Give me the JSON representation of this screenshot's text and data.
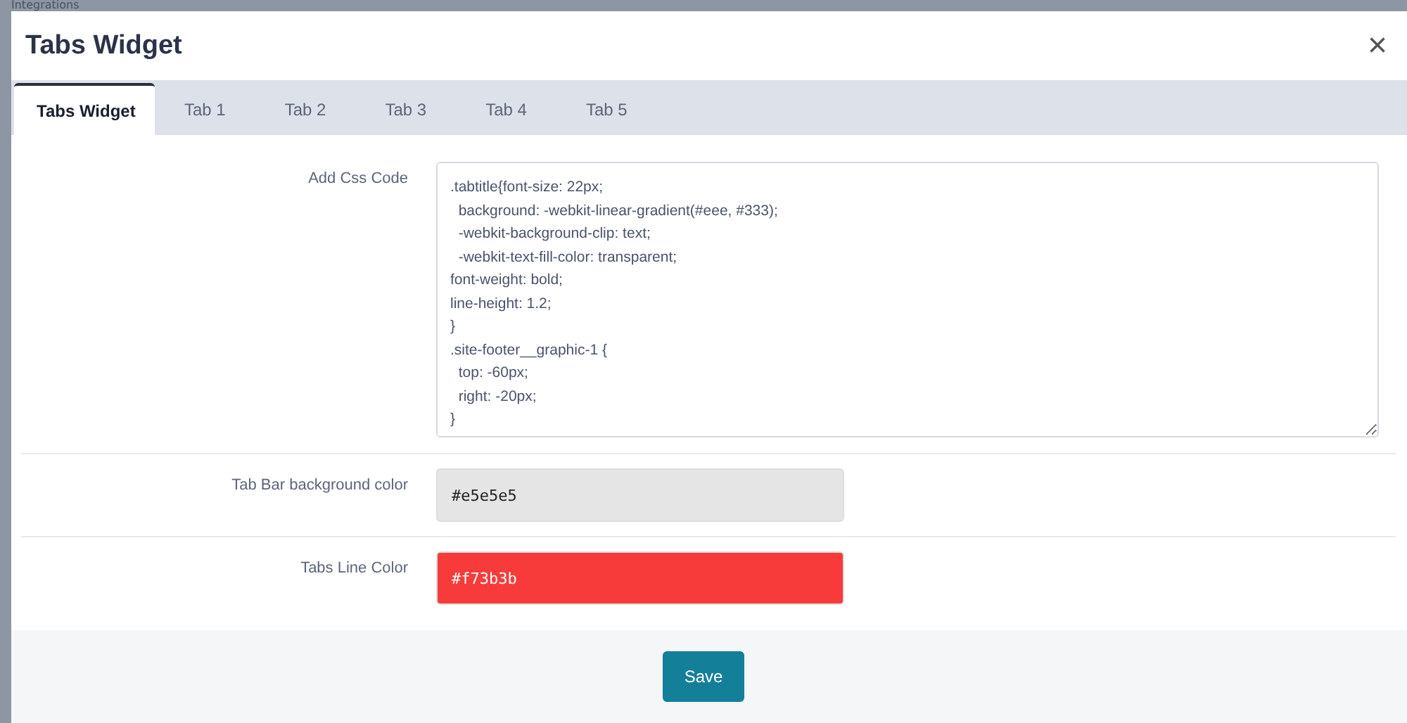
{
  "backdrop": {
    "sidebar_label": "Integrations"
  },
  "dialog": {
    "title": "Tabs Widget",
    "close": "×"
  },
  "tabs": [
    {
      "label": "Tabs Widget",
      "selected": true
    },
    {
      "label": "Tab 1",
      "selected": false
    },
    {
      "label": "Tab 2",
      "selected": false
    },
    {
      "label": "Tab 3",
      "selected": false
    },
    {
      "label": "Tab 4",
      "selected": false
    },
    {
      "label": "Tab 5",
      "selected": false
    }
  ],
  "fields": [
    {
      "kind": "code",
      "label": "Add Css Code",
      "lines": [
        ".tabtitle{font-size: 22px;",
        "  background: -webkit-linear-gradient(#eee, #333);",
        "  -webkit-background-clip: text;",
        "  -webkit-text-fill-color: transparent;",
        "font-weight: bold;",
        "line-height: 1.2;",
        "}",
        ".site-footer__graphic-1 {",
        "  top: -60px;",
        "  right: -20px;",
        "}"
      ]
    },
    {
      "kind": "color",
      "label": "Tab Bar background color",
      "value": "#e5e5e5",
      "color": "#e5e5e5"
    },
    {
      "kind": "color",
      "label": "Tabs Line Color",
      "value": "#f73b3b",
      "color": "#f73b3b"
    }
  ],
  "save_button": "Save"
}
